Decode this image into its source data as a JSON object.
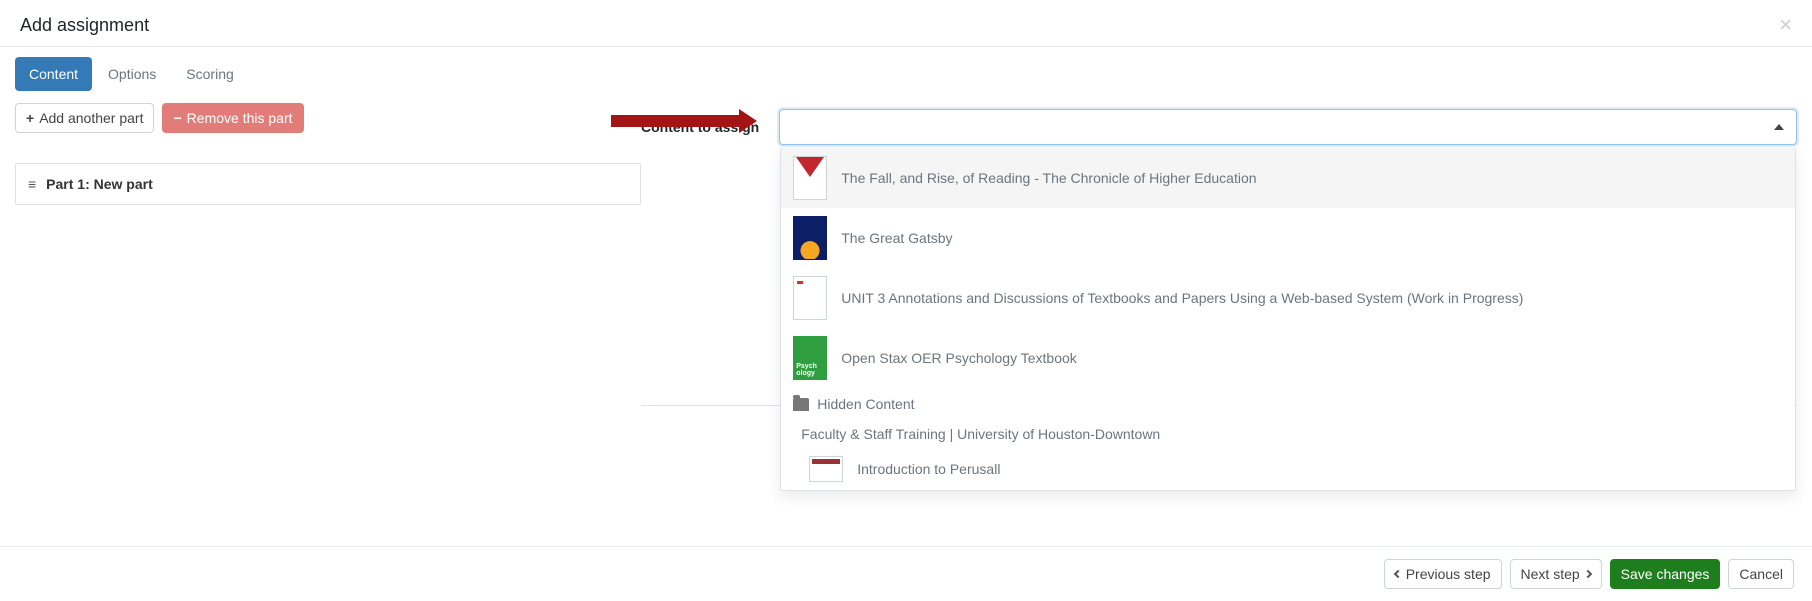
{
  "modal": {
    "title": "Add assignment"
  },
  "tabs": [
    {
      "label": "Content",
      "active": true
    },
    {
      "label": "Options",
      "active": false
    },
    {
      "label": "Scoring",
      "active": false
    }
  ],
  "buttons": {
    "add_part": "Add another part",
    "remove_part": "Remove this part"
  },
  "parts": [
    {
      "label": "Part 1: New part"
    }
  ],
  "content_assign": {
    "label": "Content to assign",
    "selected": "",
    "options": [
      {
        "title": "The Fall, and Rise, of Reading - The Chronicle of Higher Education",
        "thumb": "red-tri"
      },
      {
        "title": "The Great Gatsby",
        "thumb": "gatsby"
      },
      {
        "title": "UNIT 3 Annotations and Discussions of Textbooks and Papers Using a Web-based System (Work in Progress)",
        "thumb": "blank"
      },
      {
        "title": "Open Stax OER Psychology Textbook",
        "thumb": "green"
      }
    ],
    "folder": {
      "label": "Hidden Content"
    },
    "group_heading": "Faculty & Staff Training | University of Houston-Downtown",
    "sublist": [
      {
        "title": "Introduction to Perusall",
        "thumb": "perusall"
      }
    ]
  },
  "footer": {
    "prev": "Previous step",
    "next": "Next step",
    "save": "Save changes",
    "cancel": "Cancel"
  }
}
